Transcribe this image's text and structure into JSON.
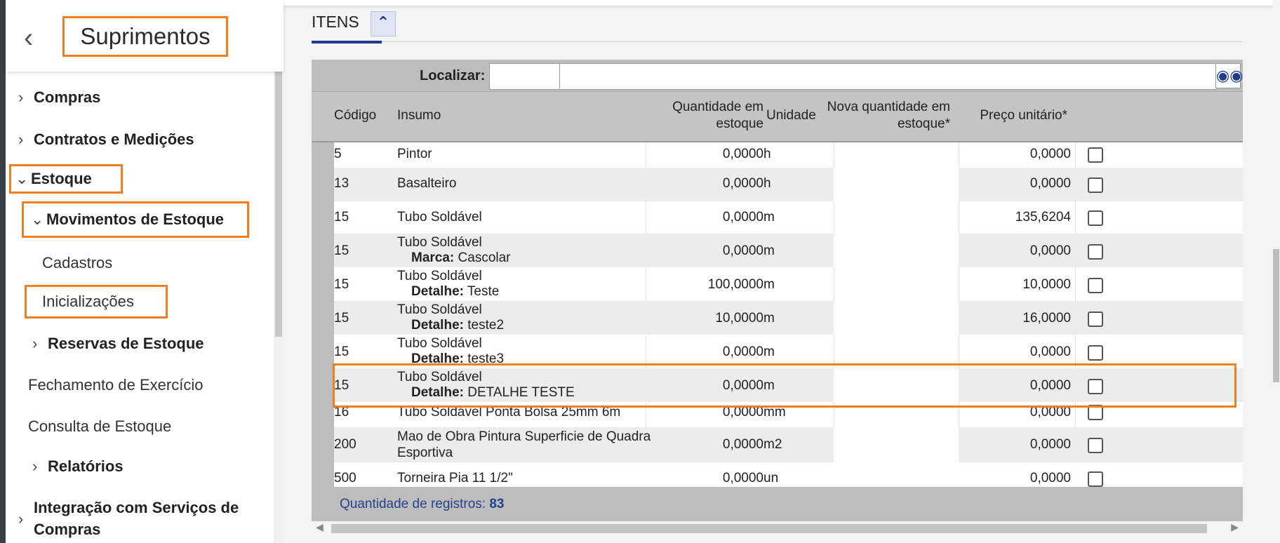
{
  "sidebar": {
    "back_icon": "chevron-left-icon",
    "title": "Suprimentos",
    "items": [
      {
        "label": "Compras",
        "expanded": false
      },
      {
        "label": "Contratos e Medições",
        "expanded": false
      },
      {
        "label": "Estoque",
        "expanded": true
      },
      {
        "label": "Movimentos de Estoque",
        "expanded": true
      },
      {
        "label": "Cadastros"
      },
      {
        "label": "Inicializações"
      },
      {
        "label": "Reservas de Estoque",
        "expanded": false
      },
      {
        "label": "Fechamento de Exercício"
      },
      {
        "label": "Consulta de Estoque"
      },
      {
        "label": "Relatórios",
        "expanded": false
      },
      {
        "label": "Integração com Serviços de"
      },
      {
        "label": "Compras"
      }
    ]
  },
  "main": {
    "tab_label": "ITENS",
    "collapse_icon": "double-chevron-up-icon",
    "search": {
      "label": "Localizar:",
      "value_small": "",
      "value_big": "",
      "search_icon": "binoculars-icon"
    },
    "columns": {
      "codigo": "Código",
      "insumo": "Insumo",
      "qtd_line1": "Quantidade em",
      "qtd_line2": "estoque",
      "unidade": "Unidade",
      "nova_line1": "Nova quantidade em",
      "nova_line2": "estoque*",
      "preco": "Preço unitário*"
    },
    "rows": [
      {
        "codigo": "5",
        "insumo": "Pintor",
        "detail_key": "",
        "detail_value": "",
        "qtd": "0,0000",
        "unidade": "h",
        "nova": "",
        "preco": "0,0000"
      },
      {
        "codigo": "13",
        "insumo": "Basalteiro",
        "detail_key": "",
        "detail_value": "",
        "qtd": "0,0000",
        "unidade": "h",
        "nova": "",
        "preco": "0,0000"
      },
      {
        "codigo": "15",
        "insumo": "Tubo Soldável",
        "detail_key": "",
        "detail_value": "",
        "qtd": "0,0000",
        "unidade": "m",
        "nova": "",
        "preco": "135,6204"
      },
      {
        "codigo": "15",
        "insumo": "Tubo Soldável",
        "detail_key": "Marca:",
        "detail_value": "Cascolar",
        "qtd": "0,0000",
        "unidade": "m",
        "nova": "",
        "preco": "0,0000"
      },
      {
        "codigo": "15",
        "insumo": "Tubo Soldável",
        "detail_key": "Detalhe:",
        "detail_value": "Teste",
        "qtd": "100,0000",
        "unidade": "m",
        "nova": "",
        "preco": "10,0000"
      },
      {
        "codigo": "15",
        "insumo": "Tubo Soldável",
        "detail_key": "Detalhe:",
        "detail_value": "teste2",
        "qtd": "10,0000",
        "unidade": "m",
        "nova": "",
        "preco": "16,0000"
      },
      {
        "codigo": "15",
        "insumo": "Tubo Soldável",
        "detail_key": "Detalhe:",
        "detail_value": "teste3",
        "qtd": "0,0000",
        "unidade": "m",
        "nova": "",
        "preco": "0,0000"
      },
      {
        "codigo": "15",
        "insumo": "Tubo Soldável",
        "detail_key": "Detalhe:",
        "detail_value": "DETALHE TESTE",
        "qtd": "0,0000",
        "unidade": "m",
        "nova": "",
        "preco": "0,0000"
      },
      {
        "codigo": "16",
        "insumo": "Tubo Soldável Ponta Bolsa 25mm 6m",
        "detail_key": "",
        "detail_value": "",
        "qtd": "0,0000",
        "unidade": "mm",
        "nova": "",
        "preco": "0,0000"
      },
      {
        "codigo": "200",
        "insumo": "Mao de Obra Pintura Superficie de Quadra",
        "insumo_line2": "Esportiva",
        "detail_key": "",
        "detail_value": "",
        "qtd": "0,0000",
        "unidade": "m2",
        "nova": "",
        "preco": "0,0000"
      },
      {
        "codigo": "500",
        "insumo": "Torneira Pia 11 1/2\"",
        "detail_key": "",
        "detail_value": "",
        "qtd": "0,0000",
        "unidade": "un",
        "nova": "",
        "preco": "0,0000"
      }
    ],
    "footer": {
      "label": "Quantidade de registros:",
      "count": "83"
    }
  },
  "colors": {
    "highlight": "#f07f22",
    "accent": "#1f3b8f"
  }
}
